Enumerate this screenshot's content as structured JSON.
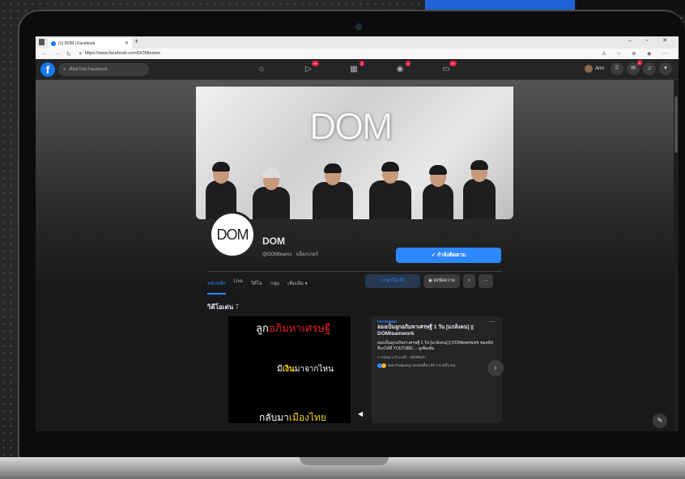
{
  "browser": {
    "tab_title": "(1) DOM | Facebook",
    "new_tab": "+",
    "url": "https://www.facebook.com/DOMteams",
    "window_controls": "– ▫ ✕"
  },
  "header": {
    "search_placeholder": "ค้นหาบน Facebook",
    "badges": [
      "9+",
      "2",
      "5",
      "9+"
    ],
    "profile_name": "Arm",
    "messenger_badge": "1"
  },
  "page": {
    "cover_logo": "DOM",
    "avatar_logo": "DOM",
    "name": "DOM",
    "handle": "@DOMteams · บล็อกเกอร์",
    "follow_label": "กำลังติดตาม",
    "tabs": [
      "หน้าหลัก",
      "Live",
      "วิดีโอ",
      "กลุ่ม",
      "เพิ่มเติม ▾"
    ],
    "like_label": "ถูกใจแล้ว",
    "message_label": "ส่งข้อความ",
    "section_title": "วิดีโอเด่น",
    "section_count": "7"
  },
  "video": {
    "line1_a": "ลูก",
    "line1_b": "อภิมหาเศรษฐี",
    "line2_a": "มี",
    "line2_b": "เงิน",
    "line2_c": "มาจากไหน",
    "line3_a": "กลับมา",
    "line3_b": "เมืองไทย",
    "featured": "FEATURED",
    "title": "ลองเป็นลูกอภิมหาเศรษฐี 1 วัน [แกล้งคน] || DOMteamwork",
    "desc": "ลองเป็นลูกอภิมหาเศรษฐี 1 วัน [แกล้งคน] || DOMteamwork ชมคลิปอื่นๆได้ที่ YOUTUBE:... ดูเพิ่มเติม",
    "meta": "การรับชม 4 ล้าน ครั้ง · หนึ่งปีที่แล้ว",
    "reactions": "Sak Puttipong และคนอื่นๆ อีก 7.6 หมื่น คน",
    "more": "···"
  },
  "colors": {
    "facebook_blue": "#1877f2",
    "accent_blue": "#2d88ff",
    "dark_bg": "#18191a",
    "header_bg": "#242526"
  }
}
